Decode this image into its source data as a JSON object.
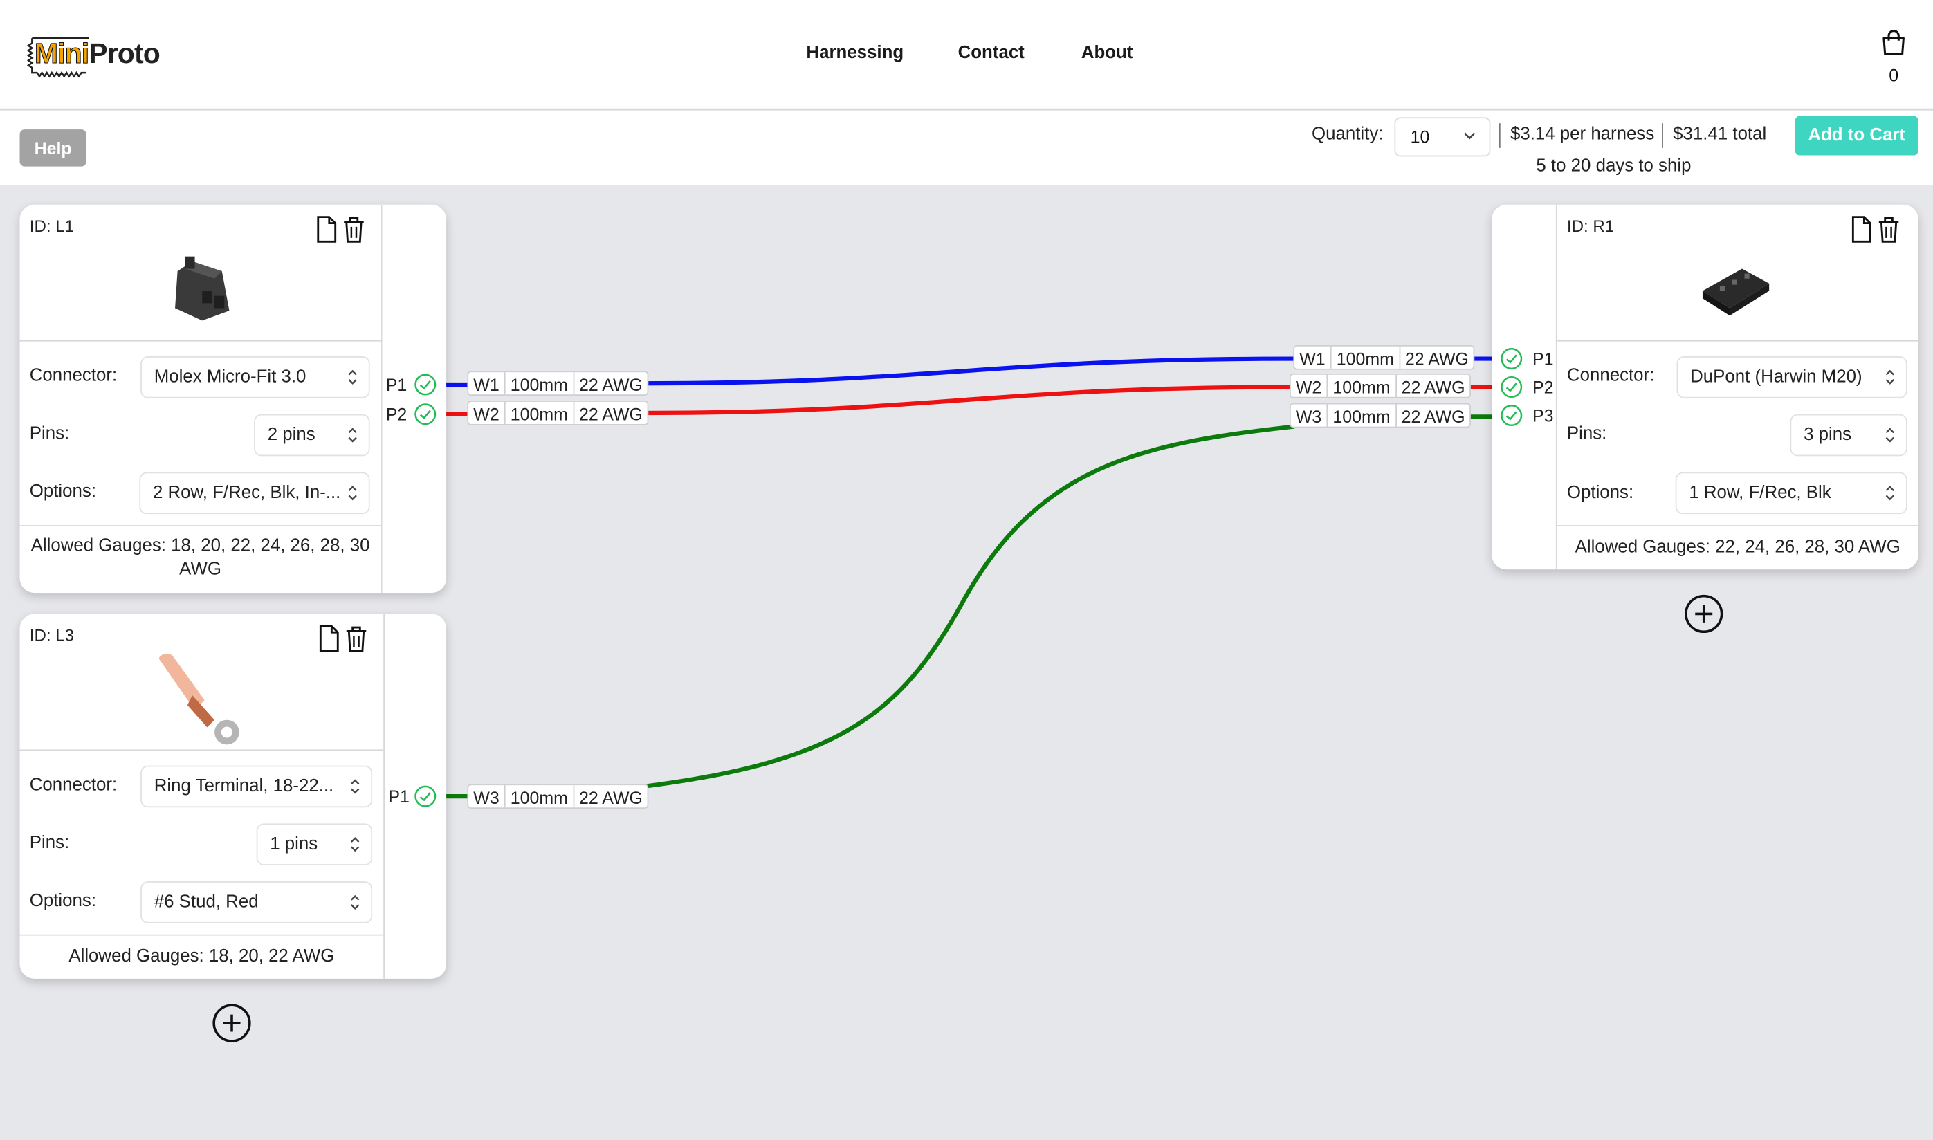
{
  "nav": {
    "logo_mini": "Mini",
    "logo_proto": "Proto",
    "links": [
      "Harnessing",
      "Contact",
      "About"
    ],
    "cart_count": "0"
  },
  "toolbar": {
    "help_label": "Help",
    "quantity_label": "Quantity:",
    "quantity_value": "10",
    "per_harness": "$3.14 per harness",
    "total": "$31.41 total",
    "ship": "5 to 20 days to ship",
    "add_to_cart": "Add to Cart"
  },
  "labels": {
    "connector": "Connector:",
    "pins": "Pins:",
    "options": "Options:"
  },
  "cards": {
    "L1": {
      "id": "ID: L1",
      "connector": "Molex Micro-Fit 3.0",
      "pins": "2 pins",
      "options": "2 Row, F/Rec, Blk, In-...",
      "gauges": "Allowed Gauges: 18, 20, 22, 24, 26, 28, 30 AWG",
      "ports": [
        "P1",
        "P2"
      ]
    },
    "L3": {
      "id": "ID: L3",
      "connector": "Ring Terminal, 18-22...",
      "pins": "1 pins",
      "options": "#6 Stud, Red",
      "gauges": "Allowed Gauges: 18, 20, 22 AWG",
      "ports": [
        "P1"
      ]
    },
    "R1": {
      "id": "ID: R1",
      "connector": "DuPont (Harwin M20)",
      "pins": "3 pins",
      "options": "1 Row, F/Rec, Blk",
      "gauges": "Allowed Gauges: 22, 24, 26, 28, 30 AWG",
      "ports": [
        "P1",
        "P2",
        "P3"
      ]
    }
  },
  "wires": [
    {
      "id": "W1",
      "length": "100mm",
      "gauge": "22 AWG",
      "color": "#0a12ee"
    },
    {
      "id": "W2",
      "length": "100mm",
      "gauge": "22 AWG",
      "color": "#ee1111"
    },
    {
      "id": "W3",
      "length": "100mm",
      "gauge": "22 AWG",
      "color": "#0c7a0c"
    }
  ],
  "colors": {
    "accent": "#3ed6c0",
    "check": "#22bb55",
    "logo_orange": "#f4a300"
  }
}
